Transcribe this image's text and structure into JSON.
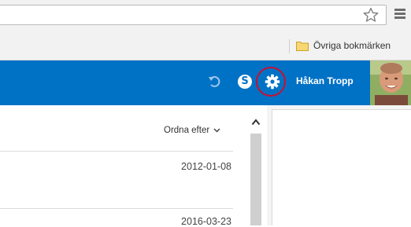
{
  "browser": {
    "bookmarks_bar": {
      "folder_label": "Övriga bokmärken"
    }
  },
  "header": {
    "user_name": "Håkan Tropp",
    "skype_glyph": "S",
    "icons": [
      "undo-icon",
      "skype-icon",
      "gear-icon"
    ],
    "accent_color": "#0072c6",
    "highlight_color": "#c8102e"
  },
  "list": {
    "sort_label": "Ordna efter",
    "dates": [
      "2012-01-08",
      "2016-03-23"
    ]
  }
}
